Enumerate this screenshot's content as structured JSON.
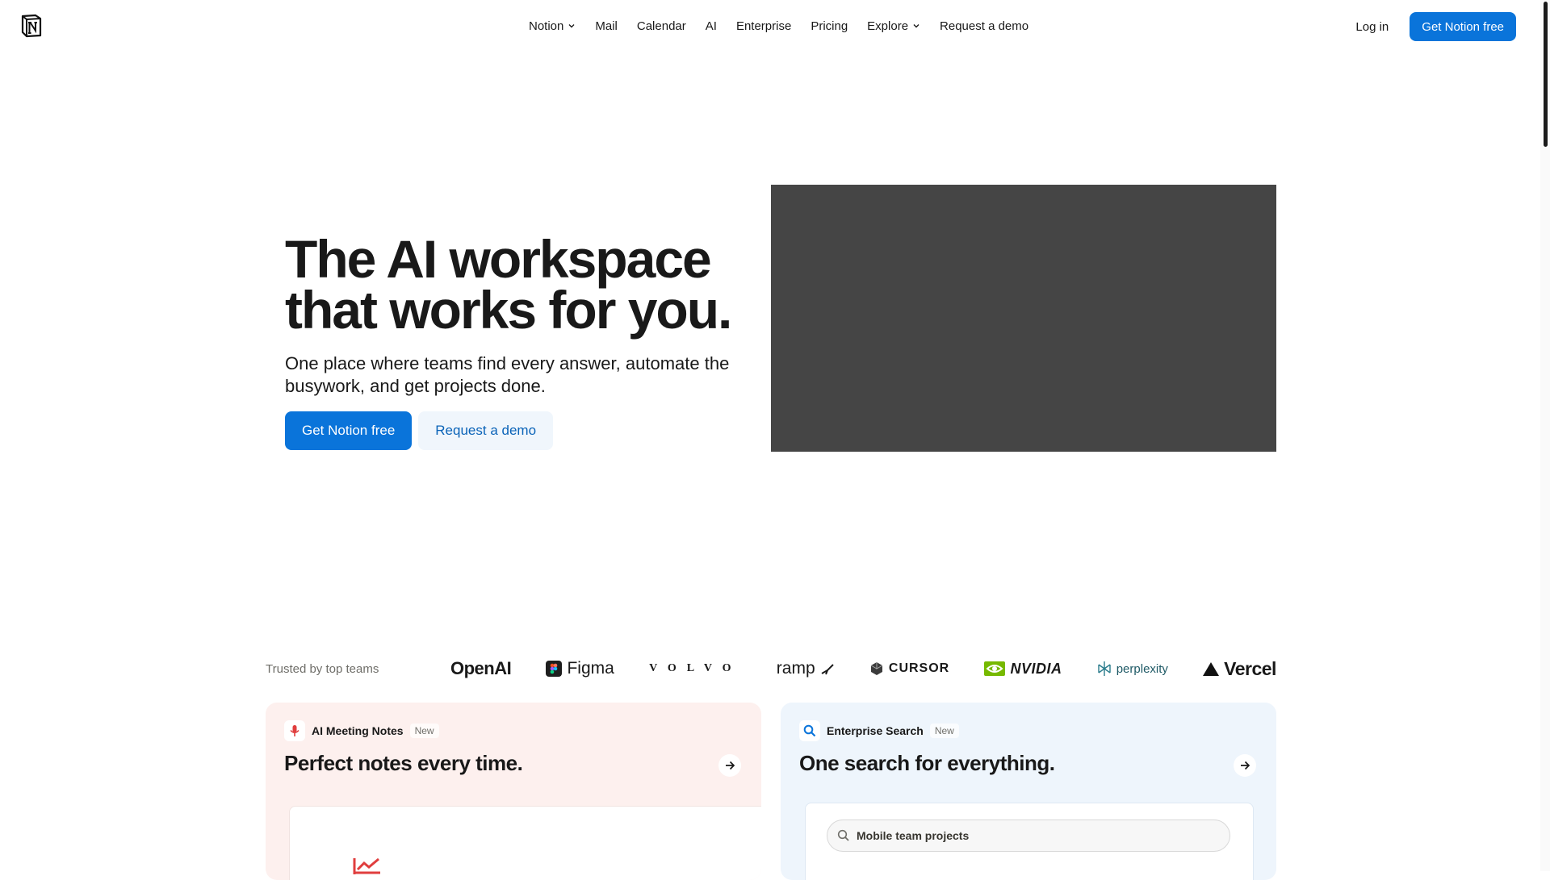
{
  "nav": {
    "items": [
      {
        "label": "Notion",
        "has_dropdown": true
      },
      {
        "label": "Mail",
        "has_dropdown": false
      },
      {
        "label": "Calendar",
        "has_dropdown": false
      },
      {
        "label": "AI",
        "has_dropdown": false
      },
      {
        "label": "Enterprise",
        "has_dropdown": false
      },
      {
        "label": "Pricing",
        "has_dropdown": false
      },
      {
        "label": "Explore",
        "has_dropdown": true
      },
      {
        "label": "Request a demo",
        "has_dropdown": false
      }
    ],
    "login_label": "Log in",
    "cta_label": "Get Notion free"
  },
  "hero": {
    "title": "The AI workspace that works for you.",
    "subtitle": "One place where teams find every answer, automate the busywork, and get projects done.",
    "primary_label": "Get Notion free",
    "secondary_label": "Request a demo"
  },
  "trusted": {
    "label": "Trusted by top teams",
    "brands": [
      "OpenAI",
      "Figma",
      "VOLVO",
      "ramp",
      "CURSOR",
      "NVIDIA",
      "perplexity",
      "Vercel"
    ]
  },
  "cards": [
    {
      "tag": "AI Meeting Notes",
      "badge": "New",
      "title": "Perfect notes every time."
    },
    {
      "tag": "Enterprise Search",
      "badge": "New",
      "title": "One search for everything.",
      "search_value": "Mobile team projects"
    }
  ],
  "colors": {
    "accent": "#0a74da",
    "secondary_bg": "#f0f6fc",
    "notes_card_bg": "#fdf0ee",
    "search_card_bg": "#eef5fc",
    "media_placeholder": "#454545"
  }
}
